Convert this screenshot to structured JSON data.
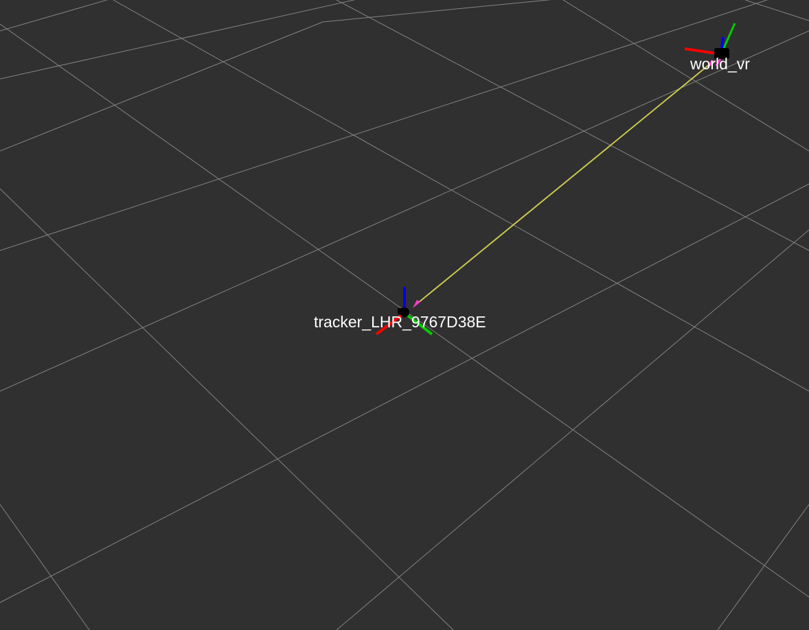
{
  "view": {
    "background_color": "#303030",
    "grid_color": "#a0a0a0"
  },
  "tf_frames": {
    "parent": {
      "name": "world_vr",
      "axis_colors": {
        "x": "#ff0000",
        "y": "#00cc00",
        "z": "#0000ff"
      }
    },
    "child": {
      "name": "tracker_LHR_9767D38E",
      "axis_colors": {
        "x": "#ff0000",
        "y": "#00cc00",
        "z": "#0000ff"
      }
    },
    "link": {
      "color": "#c8c850",
      "arrow_head_color": "#ff3cc8"
    }
  }
}
